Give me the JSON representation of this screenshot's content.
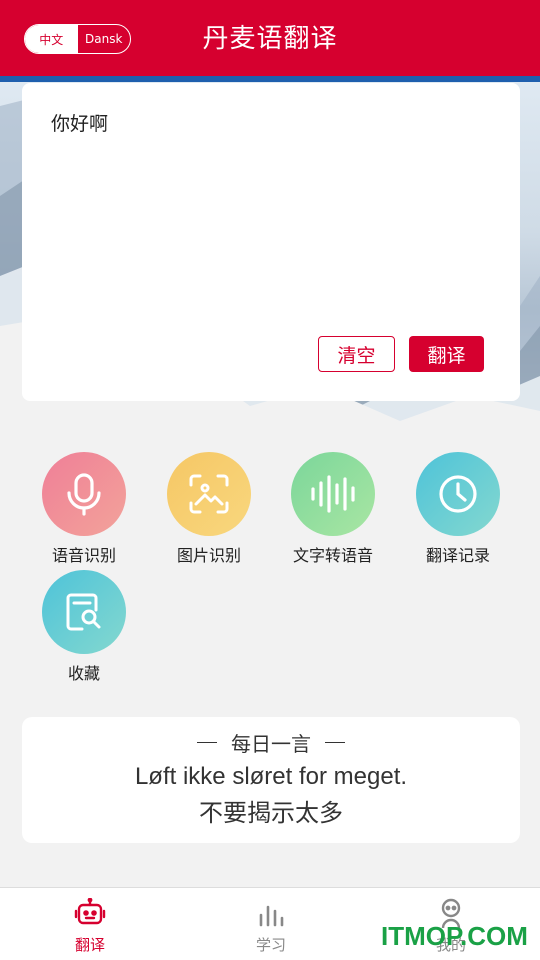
{
  "header": {
    "lang_options": [
      "中文",
      "Dansk"
    ],
    "title": "丹麦语翻译"
  },
  "input": {
    "value": "你好啊",
    "clear_label": "清空",
    "translate_label": "翻译"
  },
  "features": [
    {
      "label": "语音识别",
      "icon": "microphone-icon",
      "color": "#ef8596"
    },
    {
      "label": "图片识别",
      "icon": "image-scan-icon",
      "color": "#f7cb6a"
    },
    {
      "label": "文字转语音",
      "icon": "sound-wave-icon",
      "color": "#8adc9d"
    },
    {
      "label": "翻译记录",
      "icon": "clock-icon",
      "color": "#5cc9d6"
    },
    {
      "label": "收藏",
      "icon": "document-search-icon",
      "color": "#5cc9d6"
    }
  ],
  "daily_quote": {
    "heading": "每日一言",
    "danish": "Løft ikke sløret for meget.",
    "chinese": "不要揭示太多"
  },
  "nav": [
    {
      "label": "翻译",
      "icon": "robot-icon",
      "active": true
    },
    {
      "label": "学习",
      "icon": "bar-chart-icon",
      "active": false
    },
    {
      "label": "我的",
      "icon": "person-icon",
      "active": false
    }
  ],
  "watermark": "ITMOP.COM",
  "colors": {
    "brand": "#d6002f",
    "watermark": "#1aa146"
  }
}
